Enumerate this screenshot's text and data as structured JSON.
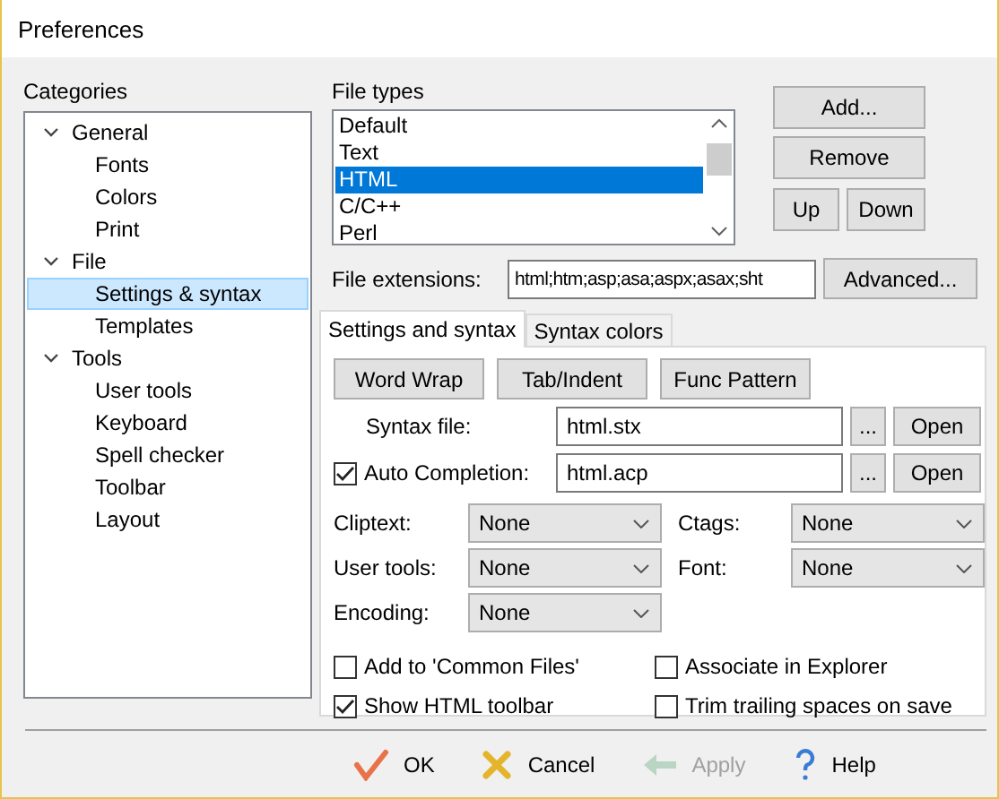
{
  "window": {
    "title": "Preferences"
  },
  "categories": {
    "label": "Categories",
    "items": [
      {
        "label": "General",
        "expanded": true,
        "selected": false,
        "children": [
          {
            "label": "Fonts",
            "selected": false
          },
          {
            "label": "Colors",
            "selected": false
          },
          {
            "label": "Print",
            "selected": false
          }
        ]
      },
      {
        "label": "File",
        "expanded": true,
        "selected": false,
        "children": [
          {
            "label": "Settings & syntax",
            "selected": true
          },
          {
            "label": "Templates",
            "selected": false
          }
        ]
      },
      {
        "label": "Tools",
        "expanded": true,
        "selected": false,
        "children": [
          {
            "label": "User tools",
            "selected": false
          },
          {
            "label": "Keyboard",
            "selected": false
          },
          {
            "label": "Spell checker",
            "selected": false
          },
          {
            "label": "Toolbar",
            "selected": false
          },
          {
            "label": "Layout",
            "selected": false
          }
        ]
      }
    ]
  },
  "file_types": {
    "label": "File types",
    "items": [
      {
        "label": "Default",
        "selected": false
      },
      {
        "label": "Text",
        "selected": false
      },
      {
        "label": "HTML",
        "selected": true
      },
      {
        "label": "C/C++",
        "selected": false
      },
      {
        "label": "Perl",
        "selected": false
      }
    ]
  },
  "list_buttons": [
    "Add...",
    "Remove"
  ],
  "order_buttons": [
    "Up",
    "Down"
  ],
  "file_extensions": {
    "label": "File extensions:",
    "value": "html;htm;asp;asa;aspx;asax;sht",
    "button": "Advanced..."
  },
  "tabs": [
    {
      "label": "Settings and syntax",
      "selected": true
    },
    {
      "label": "Syntax colors",
      "selected": false
    }
  ],
  "tool_buttons": [
    "Word Wrap",
    "Tab/Indent",
    "Func Pattern"
  ],
  "file_rows": [
    {
      "kind": "plain",
      "label": "Syntax file:",
      "value": "html.stx",
      "browse": "...",
      "open": "Open"
    },
    {
      "kind": "checkbox",
      "checked": true,
      "label": "Auto Completion:",
      "value": "html.acp",
      "browse": "...",
      "open": "Open"
    }
  ],
  "combos": [
    {
      "label": "Cliptext:",
      "value": "None"
    },
    {
      "label": "Ctags:",
      "value": "None"
    },
    {
      "label": "User tools:",
      "value": "None"
    },
    {
      "label": "Font:",
      "value": "None"
    },
    {
      "label": "Encoding:",
      "value": "None"
    }
  ],
  "options": [
    {
      "label": "Add to 'Common Files'",
      "checked": false
    },
    {
      "label": "Associate in Explorer",
      "checked": false
    },
    {
      "label": "Show HTML toolbar",
      "checked": true
    },
    {
      "label": "Trim trailing spaces on save",
      "checked": false
    }
  ],
  "footer": [
    {
      "kind": "ok",
      "label": "OK",
      "disabled": false
    },
    {
      "kind": "cancel",
      "label": "Cancel",
      "disabled": false
    },
    {
      "kind": "apply",
      "label": "Apply",
      "disabled": true
    },
    {
      "kind": "help",
      "label": "Help",
      "disabled": false
    }
  ]
}
